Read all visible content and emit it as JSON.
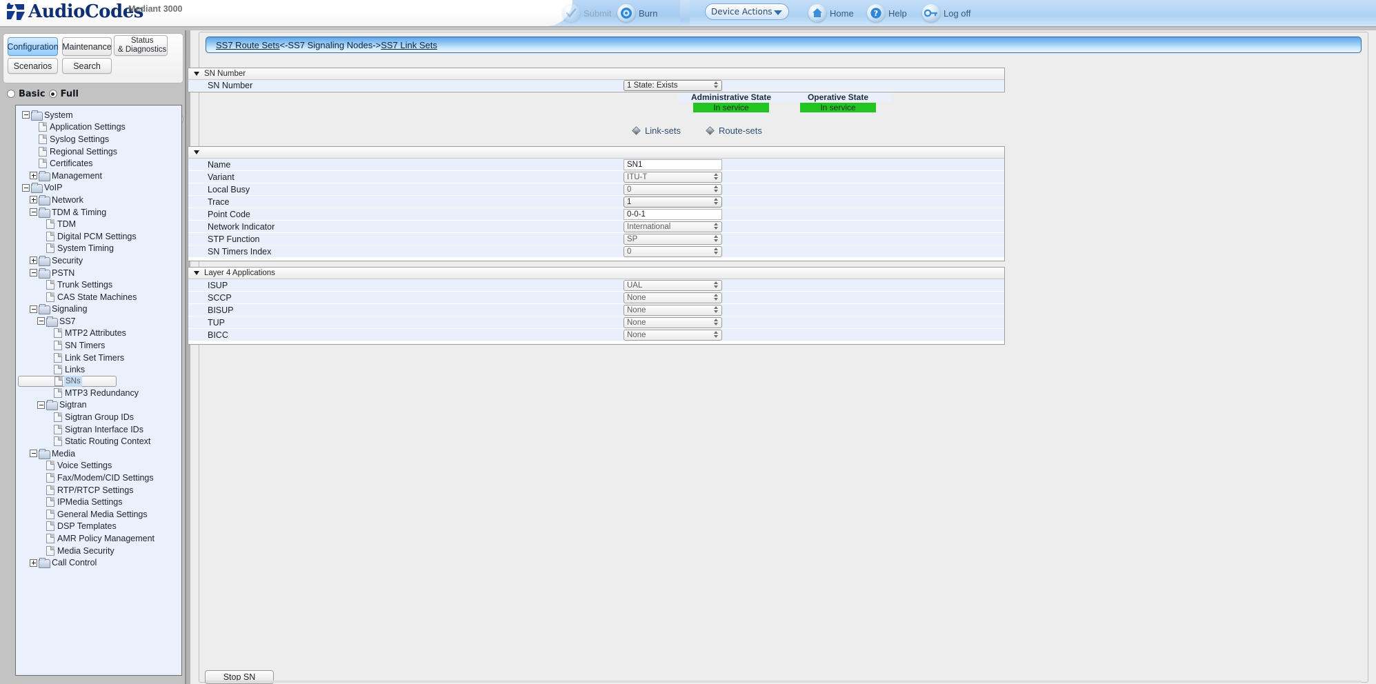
{
  "header": {
    "brand": "AudioCodes",
    "device_name": "Mediant 3000",
    "buttons": [
      {
        "label": "Submit",
        "icon": "check-icon",
        "disabled": true
      },
      {
        "label": "Burn",
        "icon": "burn-disc-icon",
        "disabled": false
      },
      {
        "label": "Home",
        "icon": "home-icon",
        "disabled": false
      },
      {
        "label": "Help",
        "icon": "question-icon",
        "disabled": false
      },
      {
        "label": "Log off",
        "icon": "key-icon",
        "disabled": false
      }
    ],
    "device_actions_label": "Device Actions"
  },
  "sidebar": {
    "tabs": [
      {
        "label": "Configuration",
        "active": true
      },
      {
        "label": "Maintenance",
        "active": false
      },
      {
        "label": "Status\n& Diagnostics",
        "active": false
      },
      {
        "label": "Scenarios",
        "active": false
      },
      {
        "label": "Search",
        "active": false
      }
    ],
    "mode": {
      "basic_label": "Basic",
      "full_label": "Full",
      "selected": "Full"
    },
    "tree": [
      {
        "label": "System",
        "type": "folder",
        "depth": 0,
        "state": "minus"
      },
      {
        "label": "Application Settings",
        "type": "doc",
        "depth": 1
      },
      {
        "label": "Syslog Settings",
        "type": "doc",
        "depth": 1
      },
      {
        "label": "Regional Settings",
        "type": "doc",
        "depth": 1
      },
      {
        "label": "Certificates",
        "type": "doc",
        "depth": 1
      },
      {
        "label": "Management",
        "type": "folder",
        "depth": 1,
        "state": "plus"
      },
      {
        "label": "VoIP",
        "type": "folder",
        "depth": 0,
        "state": "minus"
      },
      {
        "label": "Network",
        "type": "folder",
        "depth": 1,
        "state": "plus"
      },
      {
        "label": "TDM & Timing",
        "type": "folder",
        "depth": 1,
        "state": "minus"
      },
      {
        "label": "TDM",
        "type": "doc",
        "depth": 2
      },
      {
        "label": "Digital PCM Settings",
        "type": "doc",
        "depth": 2
      },
      {
        "label": "System Timing",
        "type": "doc",
        "depth": 2
      },
      {
        "label": "Security",
        "type": "folder",
        "depth": 1,
        "state": "plus"
      },
      {
        "label": "PSTN",
        "type": "folder",
        "depth": 1,
        "state": "minus"
      },
      {
        "label": "Trunk Settings",
        "type": "doc",
        "depth": 2
      },
      {
        "label": "CAS State Machines",
        "type": "doc",
        "depth": 2
      },
      {
        "label": "Signaling",
        "type": "folder",
        "depth": 1,
        "state": "minus"
      },
      {
        "label": "SS7",
        "type": "folder",
        "depth": 2,
        "state": "minus"
      },
      {
        "label": "MTP2 Attributes",
        "type": "doc",
        "depth": 3
      },
      {
        "label": "SN Timers",
        "type": "doc",
        "depth": 3
      },
      {
        "label": "Link Set Timers",
        "type": "doc",
        "depth": 3
      },
      {
        "label": "Links",
        "type": "doc",
        "depth": 3
      },
      {
        "label": "SNs",
        "type": "doc",
        "depth": 3,
        "selected": true
      },
      {
        "label": "MTP3 Redundancy",
        "type": "doc",
        "depth": 3
      },
      {
        "label": "Sigtran",
        "type": "folder",
        "depth": 2,
        "state": "minus"
      },
      {
        "label": "Sigtran Group IDs",
        "type": "doc",
        "depth": 3
      },
      {
        "label": "Sigtran Interface IDs",
        "type": "doc",
        "depth": 3
      },
      {
        "label": "Static Routing Context",
        "type": "doc",
        "depth": 3
      },
      {
        "label": "Media",
        "type": "folder",
        "depth": 1,
        "state": "minus"
      },
      {
        "label": "Voice Settings",
        "type": "doc",
        "depth": 2
      },
      {
        "label": "Fax/Modem/CID Settings",
        "type": "doc",
        "depth": 2
      },
      {
        "label": "RTP/RTCP Settings",
        "type": "doc",
        "depth": 2
      },
      {
        "label": "IPMedia Settings",
        "type": "doc",
        "depth": 2
      },
      {
        "label": "General Media Settings",
        "type": "doc",
        "depth": 2
      },
      {
        "label": "DSP Templates",
        "type": "doc",
        "depth": 2
      },
      {
        "label": "AMR Policy Management",
        "type": "doc",
        "depth": 2
      },
      {
        "label": "Media Security",
        "type": "doc",
        "depth": 2
      },
      {
        "label": "Call Control",
        "type": "folder",
        "depth": 1,
        "state": "plus"
      }
    ]
  },
  "breadcrumb": {
    "prev_link": "SS7 Route Sets",
    "prev_arrow": "<- ",
    "current": "SS7 Signaling Nodes ",
    "next_arrow": "->",
    "next_link": "SS7 Link Sets"
  },
  "sn_number_panel": {
    "title": "SN Number",
    "field_label": "SN Number",
    "field_value": "1 State: Exists"
  },
  "states": {
    "administrative_label": "Administrative State",
    "administrative_value": "In service",
    "operative_label": "Operative State",
    "operative_value": "In service",
    "badge_color": "#22c422"
  },
  "nav_links": [
    {
      "label": "Link-sets"
    },
    {
      "label": "Route-sets"
    }
  ],
  "main_panel": {
    "title": "",
    "rows": [
      {
        "label": "Name",
        "value": "SN1",
        "control": "text",
        "enabled": true
      },
      {
        "label": "Variant",
        "value": "ITU-T",
        "control": "select",
        "enabled": false
      },
      {
        "label": "Local Busy",
        "value": "0",
        "control": "select",
        "enabled": false
      },
      {
        "label": "Trace",
        "value": "1",
        "control": "select",
        "enabled": true
      },
      {
        "label": "Point Code",
        "value": "0-0-1",
        "control": "text",
        "enabled": true
      },
      {
        "label": "Network Indicator",
        "value": "International",
        "control": "select",
        "enabled": false
      },
      {
        "label": "STP Function",
        "value": "SP",
        "control": "select",
        "enabled": false
      },
      {
        "label": "SN Timers Index",
        "value": "0",
        "control": "select",
        "enabled": false
      }
    ]
  },
  "layer4_panel": {
    "title": "Layer 4 Applications",
    "rows": [
      {
        "label": "ISUP",
        "value": "UAL",
        "control": "select",
        "enabled": false
      },
      {
        "label": "SCCP",
        "value": "None",
        "control": "select",
        "enabled": false
      },
      {
        "label": "BISUP",
        "value": "None",
        "control": "select",
        "enabled": false
      },
      {
        "label": "TUP",
        "value": "None",
        "control": "select",
        "enabled": false
      },
      {
        "label": "BICC",
        "value": "None",
        "control": "select",
        "enabled": false
      }
    ]
  },
  "footer": {
    "stop_button_label": "Stop SN"
  }
}
